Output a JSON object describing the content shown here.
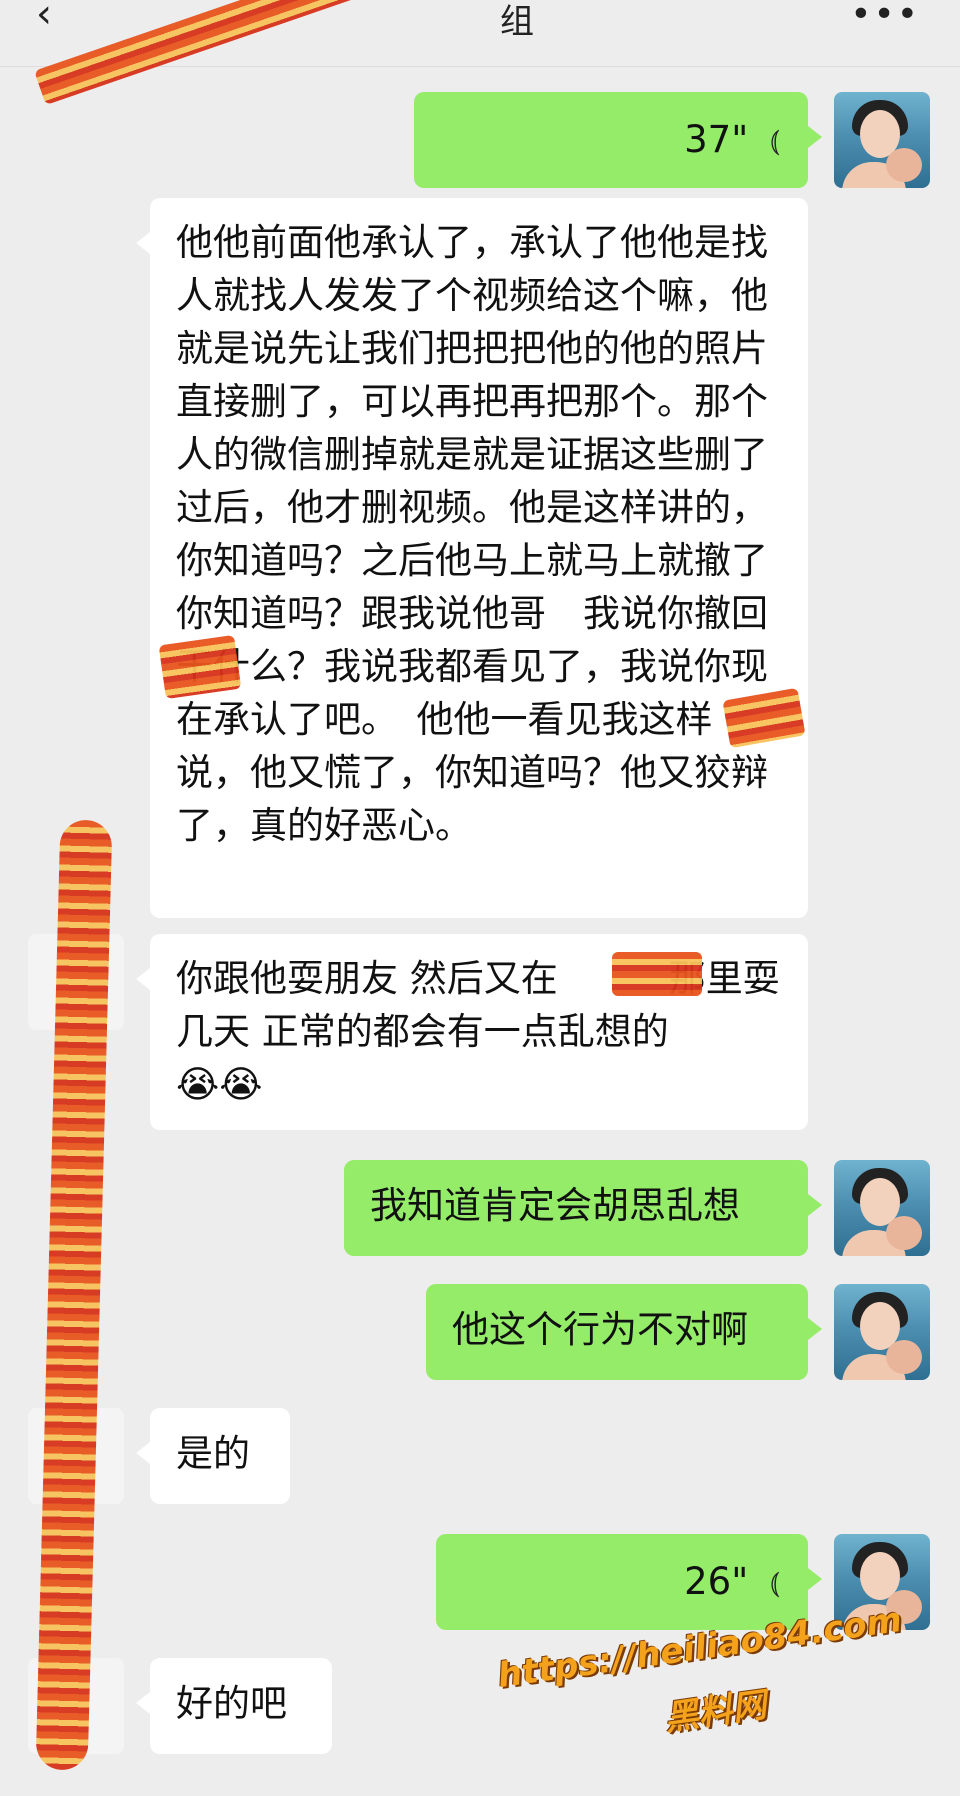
{
  "header": {
    "back_icon": "chevron-left-icon",
    "title_fragment": "组",
    "more_label": "•••"
  },
  "messages": [
    {
      "id": "m1",
      "sender": "me",
      "type": "voice",
      "duration": "37\""
    },
    {
      "id": "m2",
      "sender": "me",
      "type": "text",
      "text": "他他前面他承认了，承认了他他是找人就找人发发了个视频给这个嘛，他就是说先让我们把把把他的他的照片直接删了，可以再把再把那个。那个人的微信删掉就是就是证据这些删了过后，他才删视频。他是这样讲的，你知道吗？之后他马上就马上就撤了你知道吗？跟我说他哥　我说你撤回干什么？我说我都看见了，我说你现在承认了吧。　他他一看见我这样说，他又慌了，你知道吗？他又狡辩了，真的好恶心。"
    },
    {
      "id": "m3",
      "sender": "other",
      "type": "text",
      "text": "你跟他耍朋友 然后又在　　　那里耍几天 正常的都会有一点乱想的",
      "emoji": "😭😭"
    },
    {
      "id": "m4",
      "sender": "me",
      "type": "text",
      "text": "我知道肯定会胡思乱想"
    },
    {
      "id": "m5",
      "sender": "me",
      "type": "text",
      "text": "他这个行为不对啊"
    },
    {
      "id": "m6",
      "sender": "other",
      "type": "text",
      "text": "是的"
    },
    {
      "id": "m7",
      "sender": "me",
      "type": "voice",
      "duration": "26\""
    },
    {
      "id": "m8",
      "sender": "other",
      "type": "text",
      "text": "好的吧"
    }
  ],
  "watermark": {
    "url": "https://heiliao84.com",
    "name": "黑料网"
  },
  "colors": {
    "background": "#ededed",
    "my_bubble": "#95ec69",
    "other_bubble": "#ffffff",
    "watermark": "#f4a21c",
    "censor": "#e8541d"
  }
}
